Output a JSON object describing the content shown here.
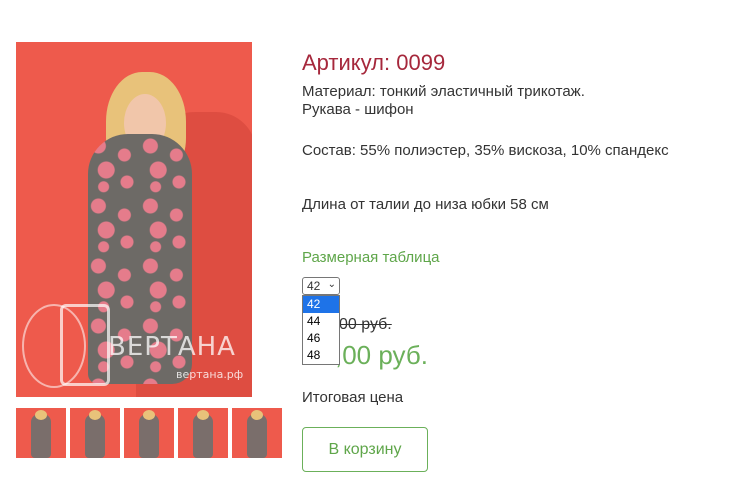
{
  "product": {
    "sku_label": "Артикул: 0099",
    "material_line1": "Материал: тонкий эластичный трикотаж.",
    "material_line2": "Рукава - шифон",
    "composition": "Состав: 55% полиэстер, 35% вискоза, 10% спандекс",
    "length": "Длина от талии до низа юбки 58 см",
    "size_table_link": "Размерная таблица"
  },
  "photo": {
    "watermark_text": "ВЕРТАНА",
    "watermark_url": "вертана.рф"
  },
  "size_select": {
    "selected": "42",
    "options": [
      "42",
      "44",
      "46",
      "48"
    ]
  },
  "price": {
    "old": "00 руб.",
    "new": ",00 руб.",
    "total_label": "Итоговая цена"
  },
  "cart": {
    "button_label": "В корзину"
  },
  "colors": {
    "accent_red": "#a6283c",
    "accent_green": "#5fa64a",
    "photo_background": "#ee5a4c"
  }
}
